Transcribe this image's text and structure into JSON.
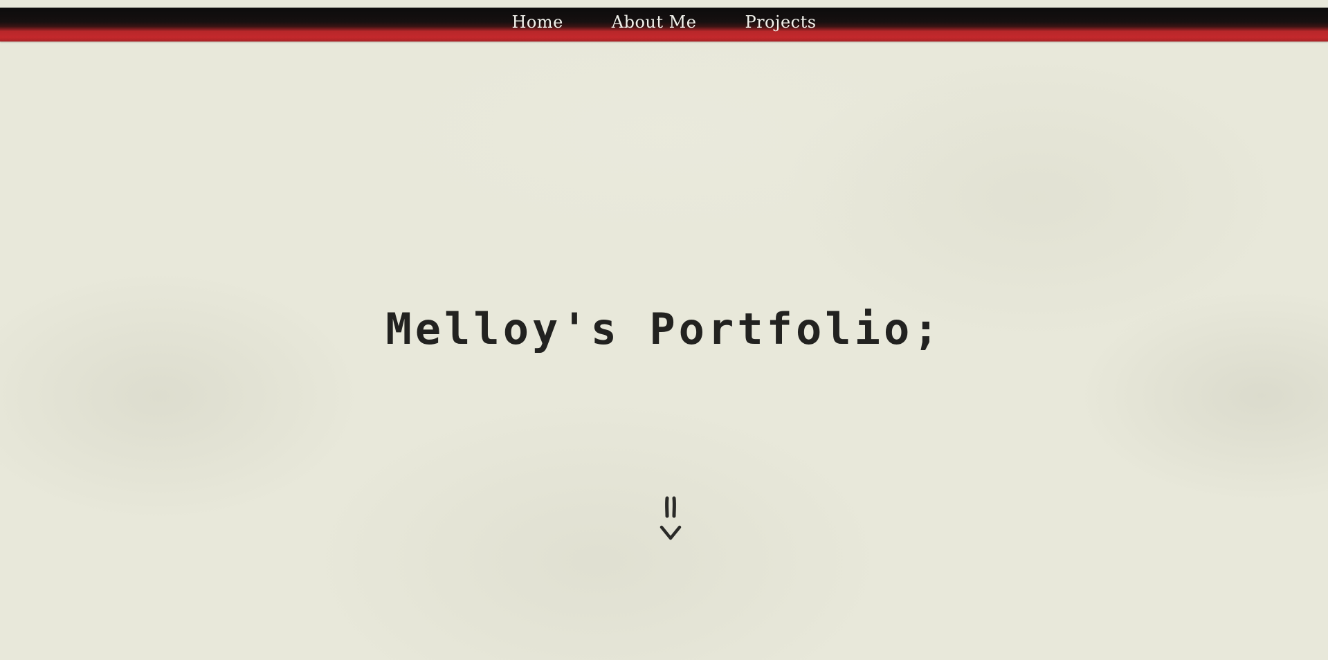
{
  "nav": {
    "items": [
      {
        "label": "Home"
      },
      {
        "label": "About Me"
      },
      {
        "label": "Projects"
      }
    ]
  },
  "hero": {
    "title": "Melloy's Portfolio;"
  },
  "colors": {
    "background": "#e8e8da",
    "nav_dark": "#0c0c0c",
    "nav_accent": "#c4292c",
    "text": "#222220"
  },
  "icons": {
    "scroll": "arrow-down-icon"
  }
}
